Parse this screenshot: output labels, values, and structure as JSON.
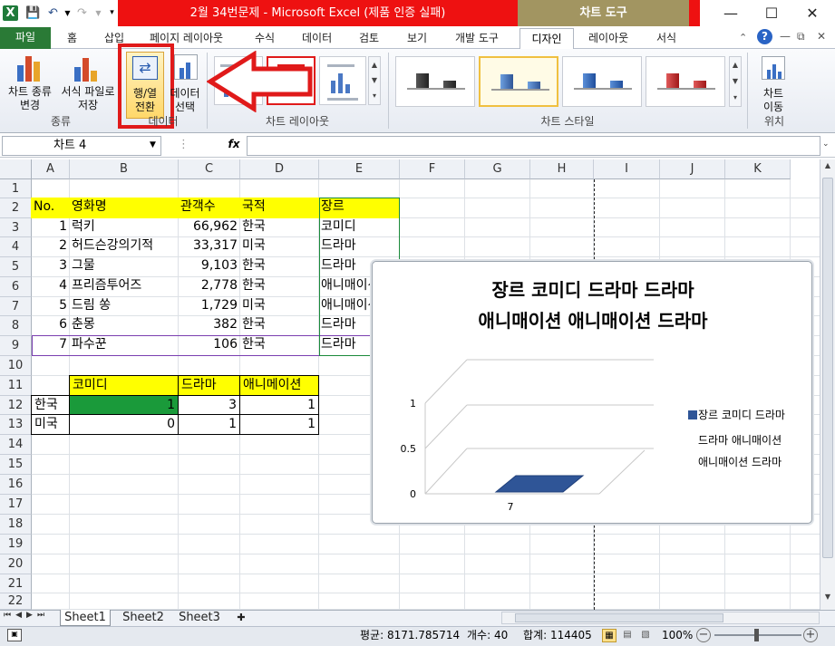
{
  "window": {
    "title": "2월 34번문제 - Microsoft Excel (제품 인증 실패)",
    "context_tab": "차트 도구",
    "accent_green": "#2a7a36",
    "title_red": "#ee1111"
  },
  "tabs": [
    "파일",
    "홈",
    "삽입",
    "페이지 레이아웃",
    "수식",
    "데이터",
    "검토",
    "보기",
    "개발 도구",
    "디자인",
    "레이아웃",
    "서식"
  ],
  "ribbon": {
    "change_type": "차트 종류\n변경",
    "save_template": "서식 파일로\n저장",
    "group_type": "종류",
    "switch_rowcol": "행/열\n전환",
    "select_data": "데이터\n선택",
    "group_data": "데이터",
    "group_layout": "차트 레이아웃",
    "group_style": "차트 스타일",
    "move_chart": "차트\n이동",
    "group_location": "위치"
  },
  "formula": {
    "name_box": "차트 4",
    "fx": "fx",
    "value": ""
  },
  "columns": [
    "A",
    "B",
    "C",
    "D",
    "E",
    "F",
    "G",
    "H",
    "I",
    "J",
    "K"
  ],
  "rows": [
    "1",
    "2",
    "3",
    "4",
    "5",
    "6",
    "7",
    "8",
    "9",
    "10",
    "11",
    "12",
    "13",
    "14",
    "15",
    "16",
    "17",
    "18",
    "19",
    "20",
    "21",
    "22"
  ],
  "table1": {
    "headers": [
      "No.",
      "영화명",
      "관객수",
      "국적",
      "장르"
    ],
    "rows": [
      [
        "1",
        "럭키",
        "66,962",
        "한국",
        "코미디"
      ],
      [
        "2",
        "허드슨강의기적",
        "33,317",
        "미국",
        "드라마"
      ],
      [
        "3",
        "그물",
        "9,103",
        "한국",
        "드라마"
      ],
      [
        "4",
        "프리즘투어즈",
        "2,778",
        "한국",
        "애니매이션"
      ],
      [
        "5",
        "드림 쏭",
        "1,729",
        "미국",
        "애니매이션"
      ],
      [
        "6",
        "춘몽",
        "382",
        "한국",
        "드라마"
      ],
      [
        "7",
        "파수꾼",
        "106",
        "한국",
        "드라마"
      ]
    ]
  },
  "table2": {
    "headers": [
      "",
      "코미디",
      "드라마",
      "애니메이션"
    ],
    "rows": [
      [
        "한국",
        "1",
        "3",
        "1"
      ],
      [
        "미국",
        "0",
        "1",
        "1"
      ]
    ]
  },
  "chart_data": {
    "type": "bar",
    "title": "장르 코미디 드라마 드라마 애니매이션 애니매이션 드라마",
    "title_lines": [
      "장르 코미디 드라마 드라마",
      "애니매이션 애니매이션 드라마"
    ],
    "categories": [
      "7"
    ],
    "series": [
      {
        "name": "장르 코미디 드라마 드라마 애니매이션 애니매이션 드라마",
        "values": [
          0
        ]
      }
    ],
    "legend_lines": [
      "장르 코미디 드라마",
      "드라마 애니매이션",
      "애니매이션 드라마"
    ],
    "y_ticks": [
      "0",
      "0.5",
      "1"
    ],
    "ylim": [
      0,
      1
    ],
    "legend_position": "right",
    "bar_color": "#2f5597"
  },
  "sheets": [
    "Sheet1",
    "Sheet2",
    "Sheet3"
  ],
  "status": {
    "average": "평균: 8171.785714",
    "count": "개수: 40",
    "sum": "합계: 114405",
    "zoom": "100%"
  }
}
